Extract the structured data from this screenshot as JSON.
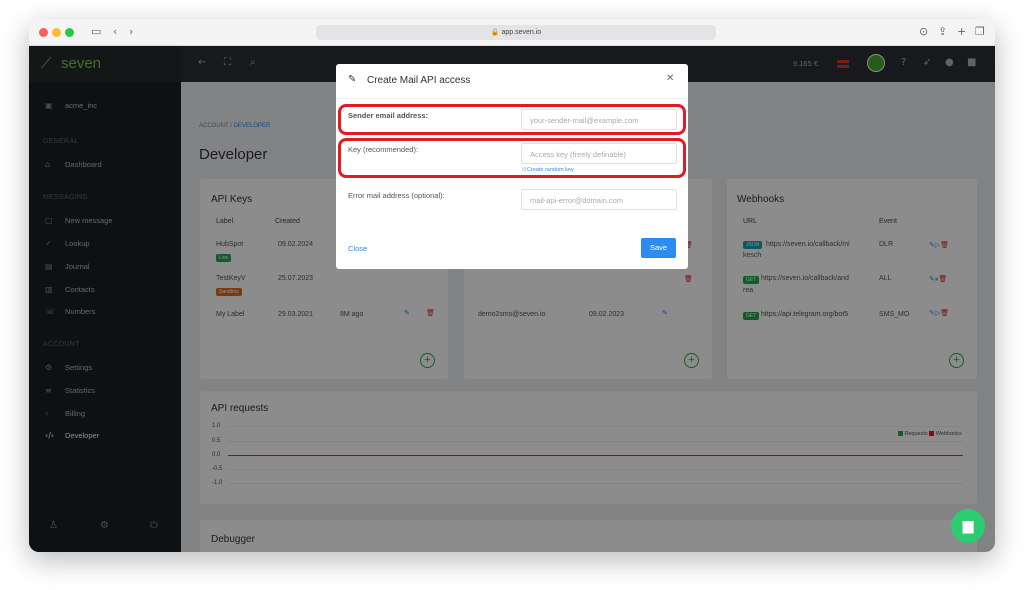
{
  "browser": {
    "url": "app.seven.io"
  },
  "sidebar": {
    "brand": "seven",
    "account_name": "acme_inc",
    "sections": {
      "general": "GENERAL",
      "messaging": "MESSAGING",
      "account": "ACCOUNT"
    },
    "items": {
      "dashboard": "Dashboard",
      "new_message": "New message",
      "lookup": "Lookup",
      "journal": "Journal",
      "contacts": "Contacts",
      "numbers": "Numbers",
      "settings": "Settings",
      "statistics": "Statistics",
      "billing": "Billing",
      "developer": "Developer"
    }
  },
  "topbar": {
    "balance": "9,165 €"
  },
  "page": {
    "breadcrumb_root": "ACCOUNT",
    "breadcrumb_sep": "/",
    "breadcrumb_current": "DEVELOPER",
    "title": "Developer"
  },
  "api_keys": {
    "title": "API Keys",
    "cols": {
      "label": "Label",
      "created": "Created"
    },
    "rows": [
      {
        "label": "HubSpot",
        "badge": "Live",
        "created": "09.02.2024",
        "ago": ""
      },
      {
        "label": "TestKeyV",
        "badge": "Sandbox",
        "created": "25.07.2023",
        "ago": ""
      },
      {
        "label": "My Label",
        "badge": "",
        "created": "29.03.2021",
        "ago": "8M ago"
      }
    ]
  },
  "mail_api": {
    "email": "demo2sms@seven.io",
    "created": "09.02.2023"
  },
  "webhooks": {
    "title": "Webhooks",
    "cols": {
      "url": "URL",
      "event": "Event"
    },
    "rows": [
      {
        "type": "JSON",
        "url": "https://seven.io/callback/mi",
        "url2": "kesch",
        "event": "DLR"
      },
      {
        "type": "GET",
        "url": "https://seven.io/callback/and",
        "url2": "rea",
        "event": "ALL"
      },
      {
        "type": "GET",
        "url": "https://api.telegram.org/bot5",
        "url2": "",
        "event": "SMS_MO"
      }
    ]
  },
  "api_requests": {
    "title": "API requests",
    "yticks": [
      "1.0",
      "0.5",
      "0.0",
      "-0.5",
      "-1.0"
    ],
    "legend": {
      "requests": "Requests",
      "webhooks": "Webhooks"
    }
  },
  "debugger": {
    "title": "Debugger"
  },
  "modal": {
    "title": "Create Mail API access",
    "sender_label": "Sender email address:",
    "sender_placeholder": "your-sender-mail@example.com",
    "key_label": "Key (recommended):",
    "key_placeholder": "Access key (freely definable)",
    "random_key": "⤨ Create random key",
    "error_label": "Error mail address (optional):",
    "error_placeholder": "mail-api-error@domain.com",
    "close": "Close",
    "save": "Save"
  },
  "colors": {
    "brand_green": "#6fcf4a",
    "sidebar": "#1b1f23",
    "save_blue": "#2d8cf0",
    "highlight_red": "#e01b24",
    "chart_red": "#c0392b"
  }
}
